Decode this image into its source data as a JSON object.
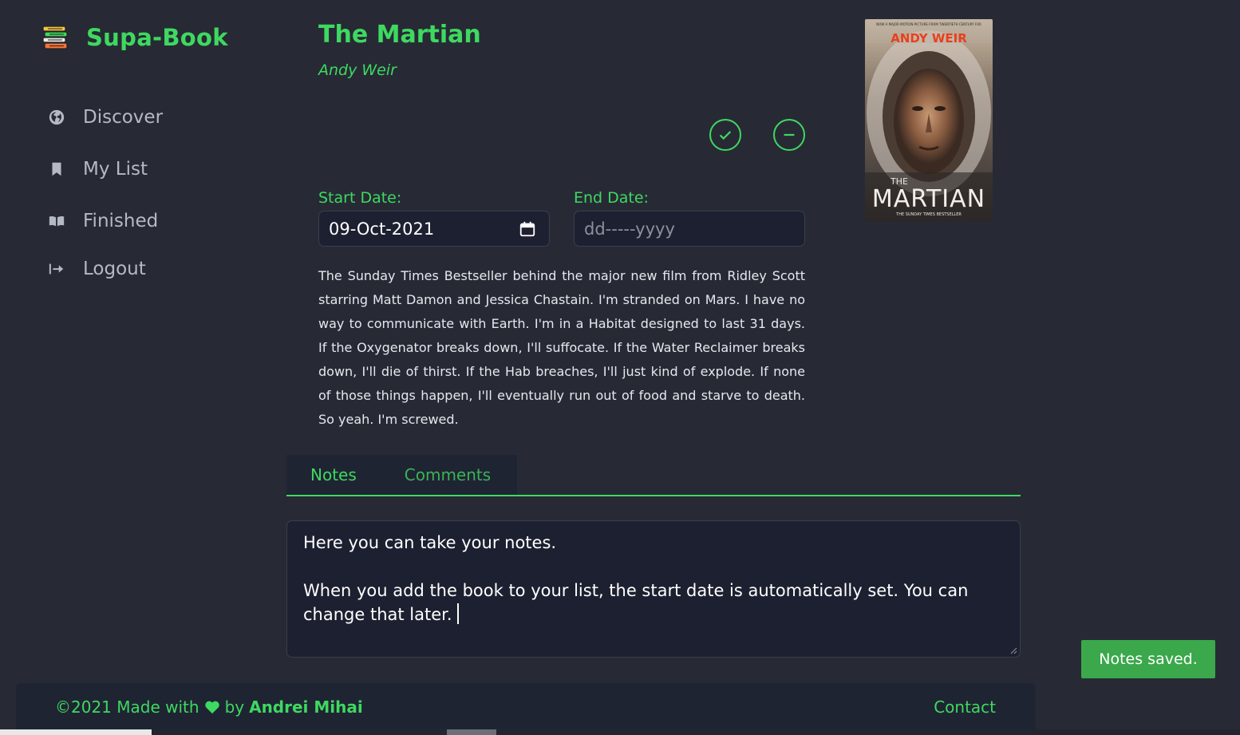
{
  "app": {
    "name": "Supa-Book"
  },
  "sidebar": {
    "items": [
      {
        "label": "Discover",
        "icon": "globe-icon"
      },
      {
        "label": "My List",
        "icon": "bookmark-icon"
      },
      {
        "label": "Finished",
        "icon": "open-book-icon"
      },
      {
        "label": "Logout",
        "icon": "logout-icon"
      }
    ]
  },
  "book": {
    "title": "The Martian",
    "author": "Andy Weir",
    "description": "The Sunday Times Bestseller behind the major new film from Ridley Scott starring Matt Damon and Jessica Chastain. I'm stranded on Mars. I have no way to communicate with Earth. I'm in a Habitat designed to last 31 days. If the Oxygenator breaks down, I'll suffocate. If the Water Reclaimer breaks down, I'll die of thirst. If the Hab breaches, I'll just kind of explode. If none of those things happen, I'll eventually run out of food and starve to death. So yeah. I'm screwed.",
    "cover": {
      "top_text": "NOW A MAJOR MOTION PICTURE FROM TWENTIETH CENTURY FOX",
      "author": "ANDY WEIR",
      "the": "THE",
      "title": "MARTIAN",
      "tagline": "THE SUNDAY TIMES BESTSELLER"
    }
  },
  "dates": {
    "start_label": "Start Date:",
    "start_value": "09-Oct-2021",
    "end_label": "End Date:",
    "end_placeholder": "dd-----yyyy"
  },
  "tabs": [
    {
      "label": "Notes",
      "active": true
    },
    {
      "label": "Comments",
      "active": false
    }
  ],
  "notes": {
    "text": "Here you can take your notes.\n\nWhen you add the book to your list, the start date is automatically set. You can change that later."
  },
  "toast": {
    "message": "Notes saved."
  },
  "footer": {
    "prefix": "©2021 Made with",
    "by": "by",
    "author": "Andrei Mihai",
    "contact": "Contact"
  },
  "colors": {
    "background": "#272a35",
    "accent": "#3ed960",
    "panel": "#1f2433",
    "toast": "#3aa84b"
  }
}
